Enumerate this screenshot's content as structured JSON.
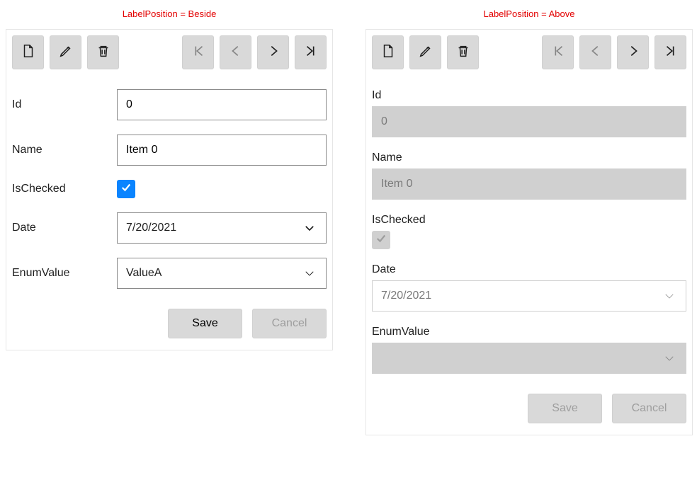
{
  "captions": {
    "beside": "LabelPosition = Beside",
    "above": "LabelPosition = Above"
  },
  "fields": {
    "id_label": "Id",
    "id_value": "0",
    "name_label": "Name",
    "name_value": "Item 0",
    "ischecked_label": "IsChecked",
    "ischecked_value": true,
    "date_label": "Date",
    "date_value": "7/20/2021",
    "enum_label": "EnumValue",
    "enum_value": "ValueA",
    "enum_value_right": ""
  },
  "buttons": {
    "save": "Save",
    "cancel": "Cancel"
  },
  "toolbar": {
    "new": "new",
    "edit": "edit",
    "delete": "delete",
    "first": "first",
    "prev": "previous",
    "next": "next",
    "last": "last"
  }
}
